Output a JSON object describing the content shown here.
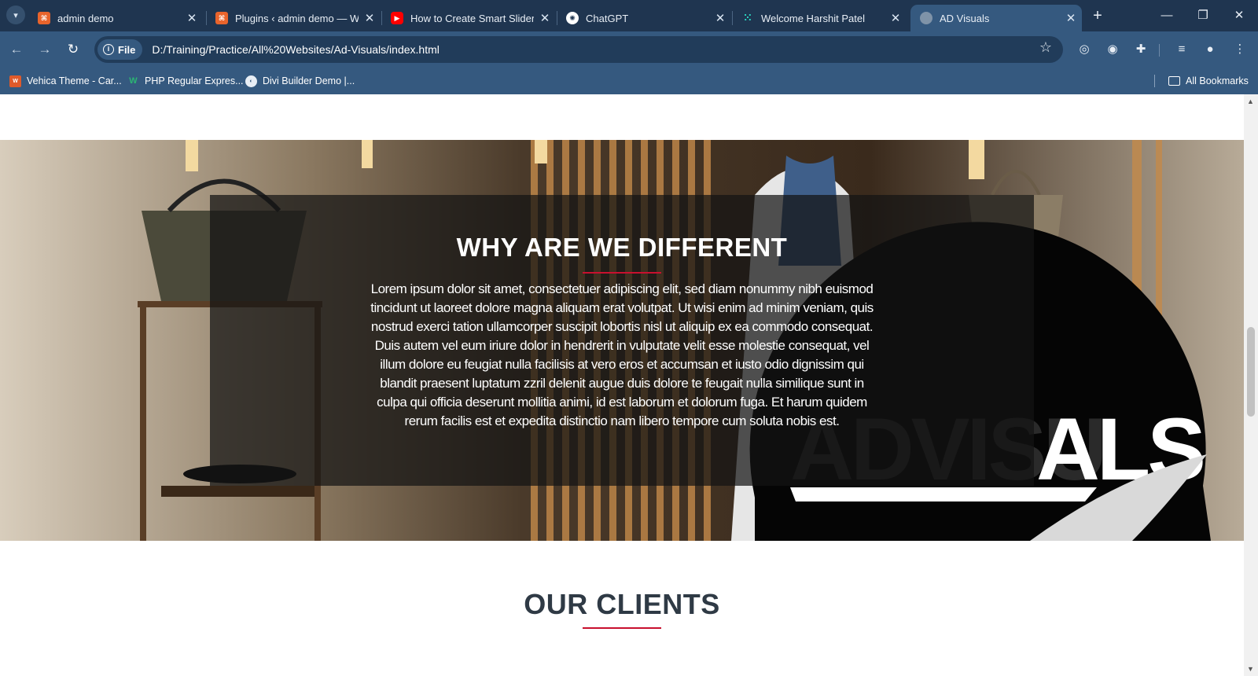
{
  "browser": {
    "tabs": [
      {
        "label": "admin demo",
        "icon": "xampp-icon",
        "color": "#e8642c"
      },
      {
        "label": "Plugins ‹ admin demo — Wo",
        "icon": "xampp-icon",
        "color": "#e8642c"
      },
      {
        "label": "How to Create Smart Slider i",
        "icon": "youtube-icon",
        "color": "#ff0000"
      },
      {
        "label": "ChatGPT",
        "icon": "chatgpt-icon",
        "color": "#ffffff"
      },
      {
        "label": "Welcome Harshit Patel",
        "icon": "dots-icon",
        "color": "#2ad4c0"
      },
      {
        "label": "AD Visuals",
        "icon": "globe-icon",
        "color": "#7f93a8"
      }
    ],
    "active_tab": 5,
    "address": {
      "chip_label": "File",
      "url": "D:/Training/Practice/All%20Websites/Ad-Visuals/index.html"
    },
    "bookmarks": [
      {
        "label": "Vehica Theme - Car...",
        "icon": "vehica-icon",
        "color": "#e05a2a"
      },
      {
        "label": "PHP Regular Expres...",
        "icon": "php-icon",
        "color": "#2bb673"
      },
      {
        "label": "Divi Builder Demo |...",
        "icon": "globe-icon",
        "color": "#e8eef5"
      }
    ],
    "all_bookmarks_label": "All Bookmarks"
  },
  "hero": {
    "title": "WHY ARE WE DIFFERENT",
    "text": "Lorem ipsum dolor sit amet, consectetuer adipiscing elit, sed diam nonummy nibh euismod tincidunt ut laoreet dolore magna aliquam erat volutpat. Ut wisi enim ad minim veniam, quis nostrud exerci tation ullamcorper suscipit lobortis nisl ut aliquip ex ea commodo consequat. Duis autem vel eum iriure dolor in hendrerit in vulputate velit esse molestie consequat, vel illum dolore eu feugiat nulla facilisis at vero eros et accumsan et iusto odio dignissim qui blandit praesent luptatum zzril delenit augue duis dolore te feugait nulla similique sunt in culpa qui officia deserunt mollitia animi, id est laborum et dolorum fuga. Et harum quidem rerum facilis est et expedita distinctio nam libero tempore cum soluta nobis est.",
    "logo_text": "ADVISUALS",
    "accent": "#c8102e"
  },
  "clients": {
    "title": "OUR CLIENTS"
  }
}
